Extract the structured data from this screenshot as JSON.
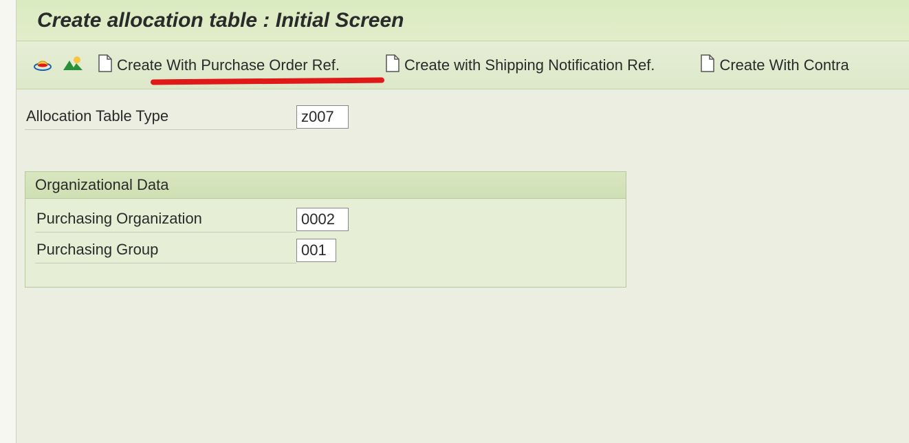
{
  "title": "Create allocation table : Initial Screen",
  "toolbar": {
    "purchase_order_label": "Create With Purchase Order Ref.",
    "shipping_notification_label": "Create with Shipping Notification Ref.",
    "contract_label": "Create With Contra"
  },
  "fields": {
    "allocation_table_type_label": "Allocation Table Type",
    "allocation_table_type_value": "z007"
  },
  "org_data": {
    "header": "Organizational Data",
    "purchasing_org_label": "Purchasing Organization",
    "purchasing_org_value": "0002",
    "purchasing_group_label": "Purchasing Group",
    "purchasing_group_value": "001"
  }
}
